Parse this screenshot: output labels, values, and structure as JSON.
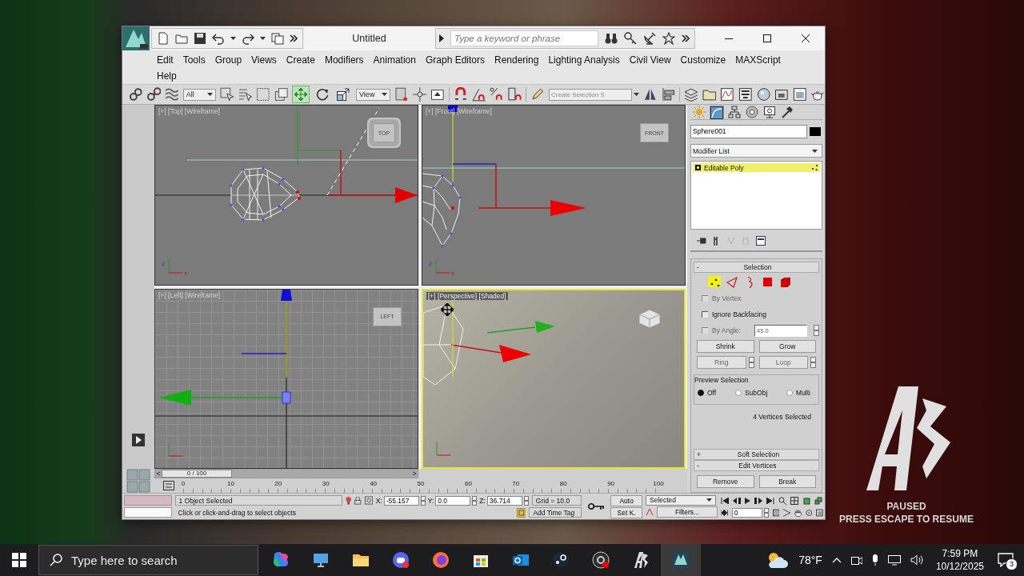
{
  "desktop": {
    "paused_title": "PAUSED",
    "paused_hint": "PRESS ESCAPE TO RESUME"
  },
  "window": {
    "title": "Untitled",
    "search": {
      "placeholder": "Type a keyword or phrase"
    }
  },
  "menu": [
    "Edit",
    "Tools",
    "Group",
    "Views",
    "Create",
    "Modifiers",
    "Animation",
    "Graph Editors",
    "Rendering",
    "Lighting Analysis",
    "Civil View",
    "Customize",
    "MAXScript",
    "Help"
  ],
  "toolbar": {
    "selection_filter": "All",
    "reference_coordinate": "View",
    "selection_set": {
      "placeholder": "Create Selection S"
    },
    "transform_tools": [
      {
        "kind": "move",
        "selected": true
      },
      {
        "kind": "rotate",
        "selected": false
      },
      {
        "kind": "scale",
        "selected": false
      }
    ]
  },
  "viewports": [
    {
      "kind": "top",
      "label": "[+] [Top] [Wireframe]",
      "cube_label": "TOP",
      "active": false,
      "axis_labels": [
        "z",
        "x"
      ]
    },
    {
      "kind": "front",
      "label": "[+] [Front] [Wireframe]",
      "cube_label": "FRONT",
      "active": false,
      "axis_labels": [
        "z",
        "x"
      ]
    },
    {
      "kind": "left",
      "label": "[+] [Left] [Wireframe]",
      "cube_label": "LEFT",
      "active": false
    },
    {
      "kind": "perspective",
      "label": "[+] [Perspective] [Shaded]",
      "active": true
    }
  ],
  "command_panel": {
    "tabs": [
      {
        "kind": "create",
        "selected": false
      },
      {
        "kind": "modify",
        "selected": true
      },
      {
        "kind": "hierarchy",
        "selected": false
      },
      {
        "kind": "motion",
        "selected": false
      },
      {
        "kind": "display",
        "selected": false
      },
      {
        "kind": "utilities",
        "selected": false
      }
    ],
    "object_name": "Sphere001",
    "modifier_list": "Modifier List",
    "stack": [
      {
        "label": "Editable Poly",
        "selected": true
      }
    ],
    "selection": {
      "toggle": "-",
      "title": "Selection",
      "levels": [
        {
          "kind": "vertex",
          "selected": true
        },
        {
          "kind": "edge",
          "selected": false
        },
        {
          "kind": "border",
          "selected": false
        },
        {
          "kind": "polygon",
          "selected": false
        },
        {
          "kind": "element",
          "selected": false
        }
      ],
      "options": [
        {
          "label": "By Vertex",
          "checked": false,
          "disabled": true
        },
        {
          "label": "Ignore Backfacing",
          "checked": false,
          "disabled": false
        },
        {
          "label": "By Angle:",
          "checked": false,
          "disabled": true
        }
      ],
      "angle": "45.0",
      "buttons": [
        {
          "label": "Shrink",
          "disabled": false,
          "spinner": false
        },
        {
          "label": "Grow",
          "disabled": false,
          "spinner": false
        },
        {
          "label": "Ring",
          "disabled": true,
          "spinner": true
        },
        {
          "label": "Loop",
          "disabled": true,
          "spinner": true
        }
      ],
      "preview": {
        "title": "Preview Selection",
        "options": [
          {
            "label": "Off",
            "selected": true
          },
          {
            "label": "SubObj",
            "selected": false
          },
          {
            "label": "Multi",
            "selected": false
          }
        ]
      },
      "summary": "4 Vertices Selected"
    },
    "rollouts": [
      {
        "toggle": "+",
        "title": "Soft Selection"
      },
      {
        "toggle": "-",
        "title": "Edit Vertices"
      }
    ],
    "edit_buttons": [
      "Remove",
      "Break"
    ]
  },
  "timeline": {
    "prev": "<",
    "frame": "0 / 100",
    "next": ">",
    "level": 0,
    "ticks": [
      "0",
      "10",
      "20",
      "30",
      "40",
      "50",
      "60",
      "70",
      "80",
      "90",
      "100"
    ]
  },
  "status": {
    "selection": "1 Object Selected",
    "prompt": "Click or click-and-drag to select objects",
    "coords": [
      {
        "label": "X:",
        "value": "-55.157"
      },
      {
        "label": "Y:",
        "value": "0.0"
      },
      {
        "label": "Z:",
        "value": "36.714"
      }
    ],
    "grid": "Grid = 10.0",
    "time_tag": "Add Time Tag",
    "auto_key": "Auto",
    "set_key": "Set K.",
    "key_filter": "Selected",
    "filters": "Filters...",
    "frame": "0"
  },
  "taskbar": {
    "search": {
      "placeholder": "Type here to search"
    },
    "apps": [
      {
        "kind": "copilot",
        "selected": false
      },
      {
        "kind": "desktop",
        "selected": false
      },
      {
        "kind": "files",
        "selected": false
      },
      {
        "kind": "chat",
        "selected": false
      },
      {
        "kind": "browser",
        "selected": false
      },
      {
        "kind": "store",
        "selected": false
      },
      {
        "kind": "mail",
        "selected": false
      },
      {
        "kind": "games",
        "selected": false
      },
      {
        "kind": "recorder",
        "selected": false
      },
      {
        "kind": "game",
        "selected": false
      },
      {
        "kind": "max",
        "selected": true
      }
    ],
    "temperature": "78°F",
    "time": "7:59 PM",
    "date": "10/12/2025",
    "notifications": "3"
  }
}
